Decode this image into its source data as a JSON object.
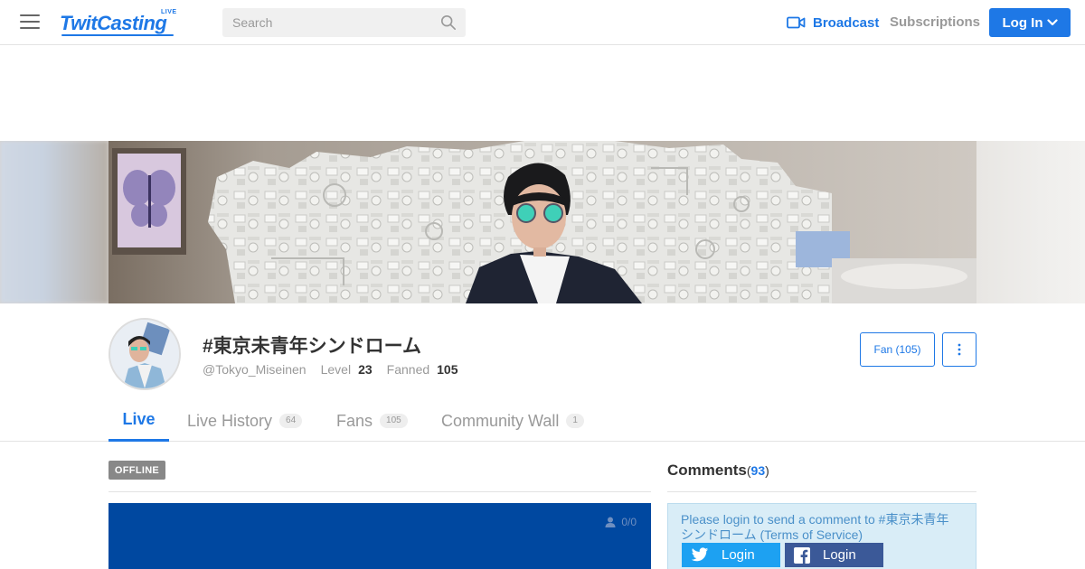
{
  "brand": {
    "logo_text": "TwitCasting",
    "logo_badge": "LIVE",
    "accent": "#1e78e6"
  },
  "search": {
    "placeholder": "Search"
  },
  "nav": {
    "broadcast": "Broadcast",
    "subscriptions": "Subscriptions",
    "login": "Log In"
  },
  "profile": {
    "name": "#東京未青年シンドローム",
    "handle": "@Tokyo_Miseinen",
    "level_label": "Level",
    "level_value": "23",
    "fanned_label": "Fanned",
    "fanned_value": "105",
    "fan_button": "Fan (105)"
  },
  "tabs": [
    {
      "label": "Live",
      "count": ""
    },
    {
      "label": "Live History",
      "count": "64"
    },
    {
      "label": "Fans",
      "count": "105"
    },
    {
      "label": "Community Wall",
      "count": "1"
    }
  ],
  "live": {
    "status": "OFFLINE",
    "viewers": "0/0"
  },
  "comments": {
    "title": "Comments",
    "count": "93",
    "login_msg_prefix": "Please login to send a comment to #東京未青年シンドローム ",
    "terms_link": "(Terms of Service)",
    "twitter_login": "Login",
    "facebook_login": "Login"
  },
  "icons": [
    "menu-icon",
    "search-icon",
    "video-camera-icon",
    "chevron-down-icon",
    "more-vertical-icon",
    "user-icon",
    "twitter-icon",
    "facebook-icon"
  ]
}
